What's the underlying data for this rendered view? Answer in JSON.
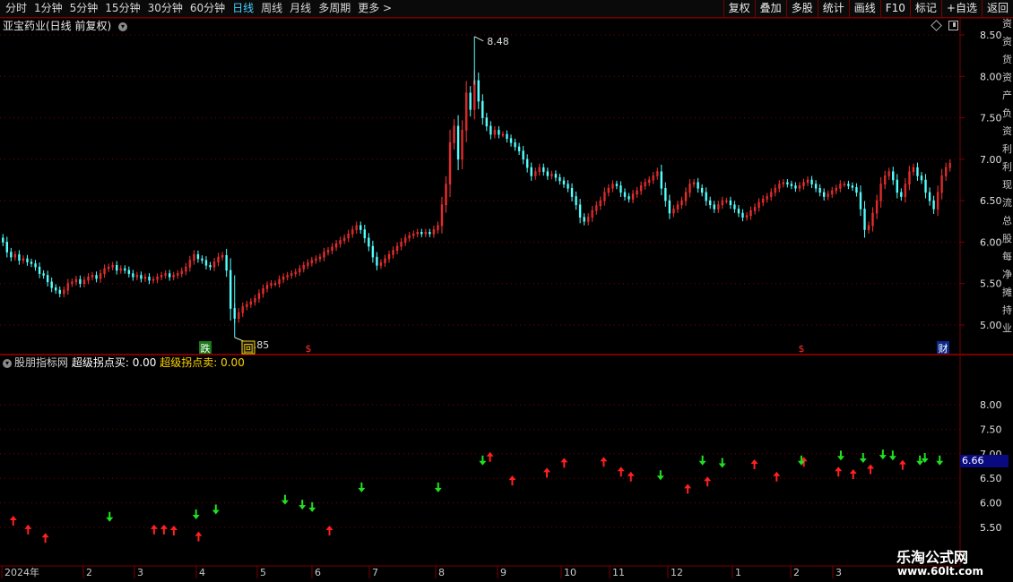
{
  "toolbar": {
    "tabs": [
      "分时",
      "1分钟",
      "5分钟",
      "15分钟",
      "30分钟",
      "60分钟",
      "日线",
      "周线",
      "月线",
      "多周期",
      "更多 >"
    ],
    "active_tab": "日线",
    "right_buttons": [
      "复权",
      "叠加",
      "多股",
      "统计",
      "画线",
      "F10",
      "标记",
      "+自选",
      "返回"
    ]
  },
  "main_chart": {
    "title": "亚宝药业(日线 前复权)",
    "price_axis": [
      "8.50",
      "8.00",
      "7.50",
      "7.00",
      "6.50",
      "6.00",
      "5.50",
      "5.00"
    ],
    "high_marker": "8.48",
    "low_marker": "4.85",
    "event_markers": [
      "跌",
      "回",
      "$",
      "$",
      "财"
    ]
  },
  "indicator": {
    "name": "股朋指标网",
    "buy_label": "超级拐点买: 0.00",
    "sell_label": "超级拐点卖: 0.00",
    "axis": [
      "8.00",
      "7.50",
      "7.00",
      "6.50",
      "6.00",
      "5.50"
    ],
    "current_value": "6.66"
  },
  "time_axis": [
    "2024年",
    "2",
    "3",
    "4",
    "5",
    "6",
    "7",
    "8",
    "9",
    "10",
    "11",
    "12",
    "1",
    "2",
    "3"
  ],
  "edge_text": [
    "资",
    "资",
    "货",
    "资",
    "产",
    "负",
    "资",
    "利",
    "利",
    "现",
    "流",
    "总",
    "股",
    "每",
    "净",
    "摊",
    "持",
    "业"
  ],
  "colors": {
    "background": "#000000",
    "up": "#ff3232",
    "down": "#54ffff",
    "buy_arrow": "#ff2020",
    "sell_arrow": "#20e020",
    "grid": "#7a0000"
  },
  "chart_data": {
    "type": "candlestick",
    "ylim": [
      4.8,
      8.6
    ],
    "closes": [
      6.0,
      5.88,
      5.82,
      5.85,
      5.78,
      5.8,
      5.76,
      5.74,
      5.7,
      5.62,
      5.6,
      5.52,
      5.45,
      5.42,
      5.38,
      5.42,
      5.5,
      5.52,
      5.55,
      5.5,
      5.54,
      5.58,
      5.6,
      5.56,
      5.62,
      5.68,
      5.7,
      5.72,
      5.66,
      5.68,
      5.66,
      5.62,
      5.58,
      5.6,
      5.56,
      5.58,
      5.54,
      5.55,
      5.58,
      5.6,
      5.62,
      5.58,
      5.6,
      5.62,
      5.65,
      5.7,
      5.78,
      5.85,
      5.8,
      5.78,
      5.72,
      5.7,
      5.76,
      5.82,
      5.84,
      5.66,
      5.2,
      5.08,
      5.15,
      5.22,
      5.25,
      5.28,
      5.32,
      5.38,
      5.44,
      5.48,
      5.5,
      5.5,
      5.55,
      5.58,
      5.6,
      5.62,
      5.64,
      5.68,
      5.72,
      5.75,
      5.78,
      5.8,
      5.82,
      5.88,
      5.9,
      5.94,
      5.98,
      6.02,
      6.05,
      6.1,
      6.15,
      6.2,
      6.15,
      6.05,
      5.95,
      5.82,
      5.72,
      5.75,
      5.8,
      5.85,
      5.9,
      5.95,
      6.0,
      6.05,
      6.08,
      6.1,
      6.12,
      6.1,
      6.12,
      6.1,
      6.15,
      6.2,
      6.45,
      6.7,
      7.2,
      7.4,
      7.0,
      7.35,
      7.8,
      7.6,
      7.95,
      7.7,
      7.5,
      7.4,
      7.3,
      7.35,
      7.3,
      7.3,
      7.25,
      7.2,
      7.15,
      7.1,
      7.0,
      6.9,
      6.8,
      6.85,
      6.9,
      6.85,
      6.8,
      6.82,
      6.78,
      6.74,
      6.7,
      6.65,
      6.55,
      6.45,
      6.3,
      6.25,
      6.3,
      6.38,
      6.44,
      6.5,
      6.6,
      6.65,
      6.7,
      6.68,
      6.6,
      6.55,
      6.52,
      6.58,
      6.62,
      6.68,
      6.72,
      6.75,
      6.8,
      6.85,
      6.65,
      6.5,
      6.35,
      6.4,
      6.45,
      6.5,
      6.6,
      6.7,
      6.72,
      6.65,
      6.6,
      6.5,
      6.45,
      6.4,
      6.45,
      6.5,
      6.5,
      6.45,
      6.4,
      6.35,
      6.3,
      6.32,
      6.38,
      6.42,
      6.48,
      6.52,
      6.55,
      6.6,
      6.65,
      6.7,
      6.72,
      6.7,
      6.68,
      6.65,
      6.68,
      6.72,
      6.75,
      6.7,
      6.65,
      6.6,
      6.55,
      6.58,
      6.62,
      6.65,
      6.7,
      6.7,
      6.68,
      6.66,
      6.6,
      6.4,
      6.15,
      6.2,
      6.35,
      6.5,
      6.7,
      6.8,
      6.85,
      6.75,
      6.6,
      6.55,
      6.7,
      6.85,
      6.9,
      6.8,
      6.75,
      6.6,
      6.5,
      6.4,
      6.6,
      6.8,
      6.9,
      6.95
    ],
    "buy_points": [
      [
        5,
        5.7
      ],
      [
        11,
        5.52
      ],
      [
        18,
        5.35
      ],
      [
        62,
        5.52
      ],
      [
        66,
        5.52
      ],
      [
        70,
        5.5
      ],
      [
        80,
        5.38
      ],
      [
        133,
        5.5
      ],
      [
        198,
        7.0
      ],
      [
        207,
        6.52
      ],
      [
        221,
        6.68
      ],
      [
        228,
        6.88
      ],
      [
        244,
        6.9
      ],
      [
        251,
        6.7
      ],
      [
        255,
        6.6
      ],
      [
        278,
        6.35
      ],
      [
        286,
        6.5
      ],
      [
        305,
        6.85
      ],
      [
        314,
        6.6
      ],
      [
        325,
        6.9
      ],
      [
        339,
        6.7
      ],
      [
        345,
        6.65
      ],
      [
        352,
        6.75
      ],
      [
        365,
        6.84
      ]
    ],
    "sell_points": [
      [
        44,
        5.65
      ],
      [
        79,
        5.7
      ],
      [
        87,
        5.8
      ],
      [
        115,
        6.0
      ],
      [
        122,
        5.9
      ],
      [
        126,
        5.85
      ],
      [
        146,
        6.25
      ],
      [
        177,
        6.25
      ],
      [
        195,
        6.8
      ],
      [
        267,
        6.5
      ],
      [
        284,
        6.8
      ],
      [
        292,
        6.75
      ],
      [
        324,
        6.8
      ],
      [
        340,
        6.9
      ],
      [
        349,
        6.85
      ],
      [
        357,
        6.92
      ],
      [
        361,
        6.9
      ],
      [
        372,
        6.8
      ],
      [
        374,
        6.85
      ],
      [
        380,
        6.8
      ]
    ]
  }
}
